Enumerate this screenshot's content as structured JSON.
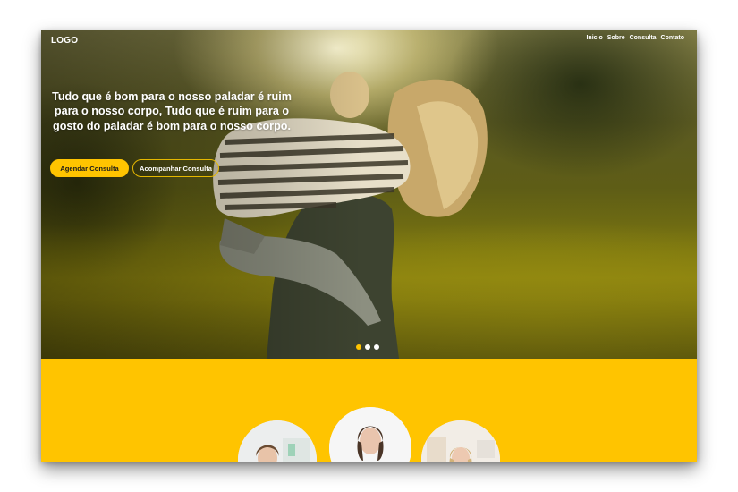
{
  "header": {
    "logo": "LOGO",
    "nav": [
      "Inicio",
      "Sobre",
      "Consulta",
      "Contato"
    ]
  },
  "hero": {
    "headline": "Tudo que é bom para o nosso paladar é ruim para o nosso corpo, Tudo que é ruim para o gosto do paladar é bom para o nosso corpo.",
    "primary_button": "Agendar Consulta",
    "secondary_button": "Acompanhar Consulta",
    "carousel": {
      "slides": 3,
      "active_index": 0
    }
  },
  "colors": {
    "accent": "#ffc400",
    "text_light": "#ffffff"
  },
  "services": {
    "doctors": [
      "doctor-photo-1",
      "doctor-photo-2",
      "doctor-photo-3"
    ]
  }
}
